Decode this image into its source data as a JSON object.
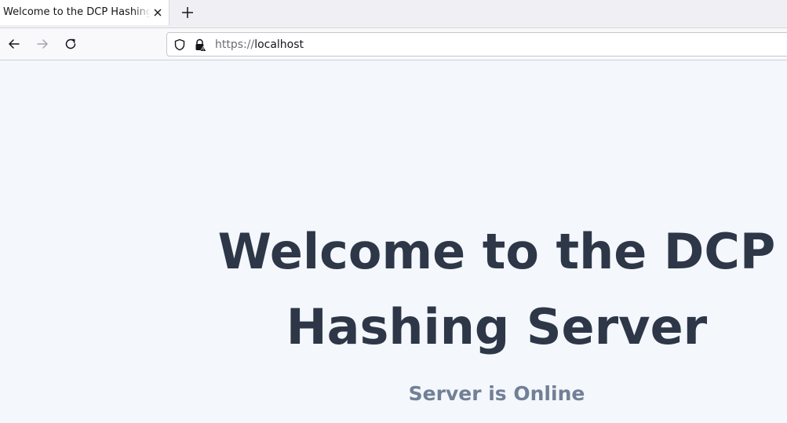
{
  "browser": {
    "tab": {
      "title": "Welcome to the DCP Hashing Server"
    },
    "url": {
      "scheme": "https://",
      "host": "localhost"
    }
  },
  "page": {
    "headline_line1": "Welcome to the DCP",
    "headline_line2": "Hashing Server",
    "status": "Server is Online"
  },
  "colors": {
    "heading": "#2d3748",
    "status": "#718096",
    "page_background": "#f4f7fb"
  },
  "icons": {
    "tab_close": "close-icon",
    "new_tab": "plus-icon",
    "back": "arrow-left-icon",
    "forward": "arrow-right-icon",
    "reload": "reload-icon",
    "tracking": "shield-icon",
    "security": "lock-warning-icon"
  }
}
